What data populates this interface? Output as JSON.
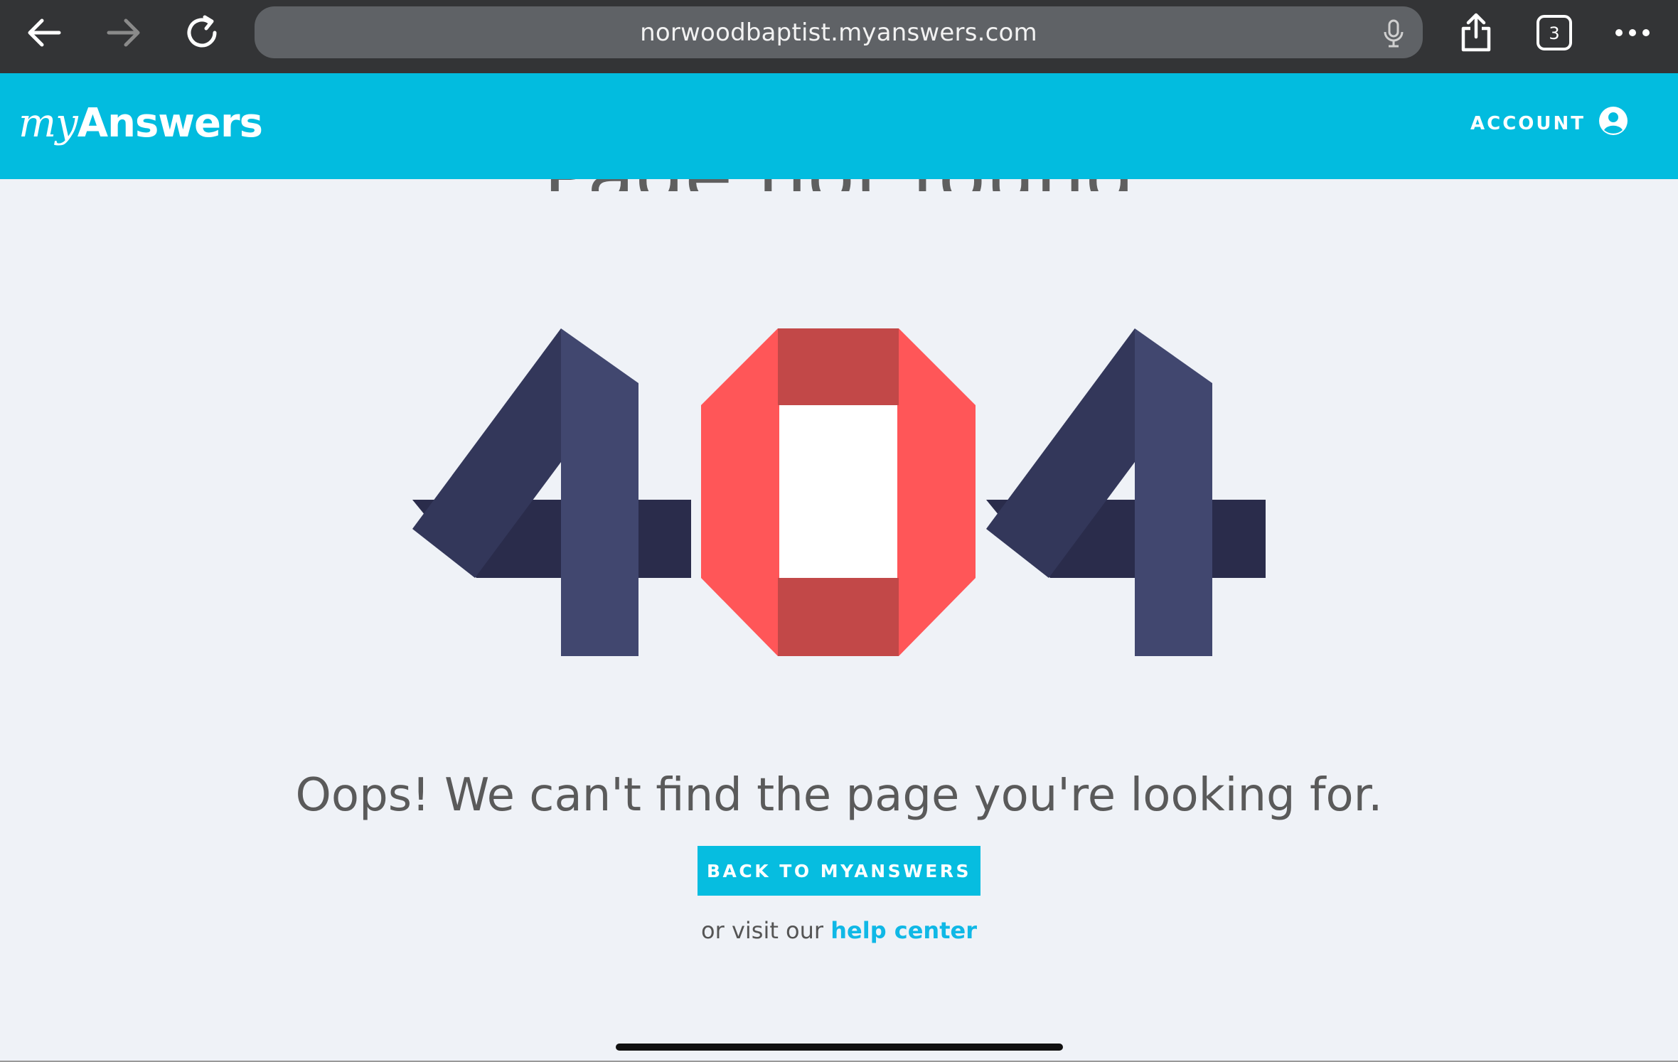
{
  "browser": {
    "url": "norwoodbaptist.myanswers.com",
    "tab_count": "3",
    "icons": [
      "back-arrow-icon",
      "forward-arrow-icon",
      "reload-icon",
      "microphone-icon",
      "share-icon",
      "tabs-icon",
      "more-icon"
    ]
  },
  "header": {
    "logo_my": "my",
    "logo_answers": "Answers",
    "account_label": "ACCOUNT"
  },
  "main": {
    "partial_title": "Page not found",
    "error_code": "404",
    "message": "Oops! We can't find the page you're looking for.",
    "back_button_label": "BACK TO MYANSWERS",
    "help_prefix": "or visit our",
    "help_link_label": "help center"
  },
  "colors": {
    "header": "#02bcdf",
    "four_light": "#41476f",
    "four_dark": "#33375a",
    "zero_light": "#ff5658",
    "zero_dark": "#c24848"
  }
}
